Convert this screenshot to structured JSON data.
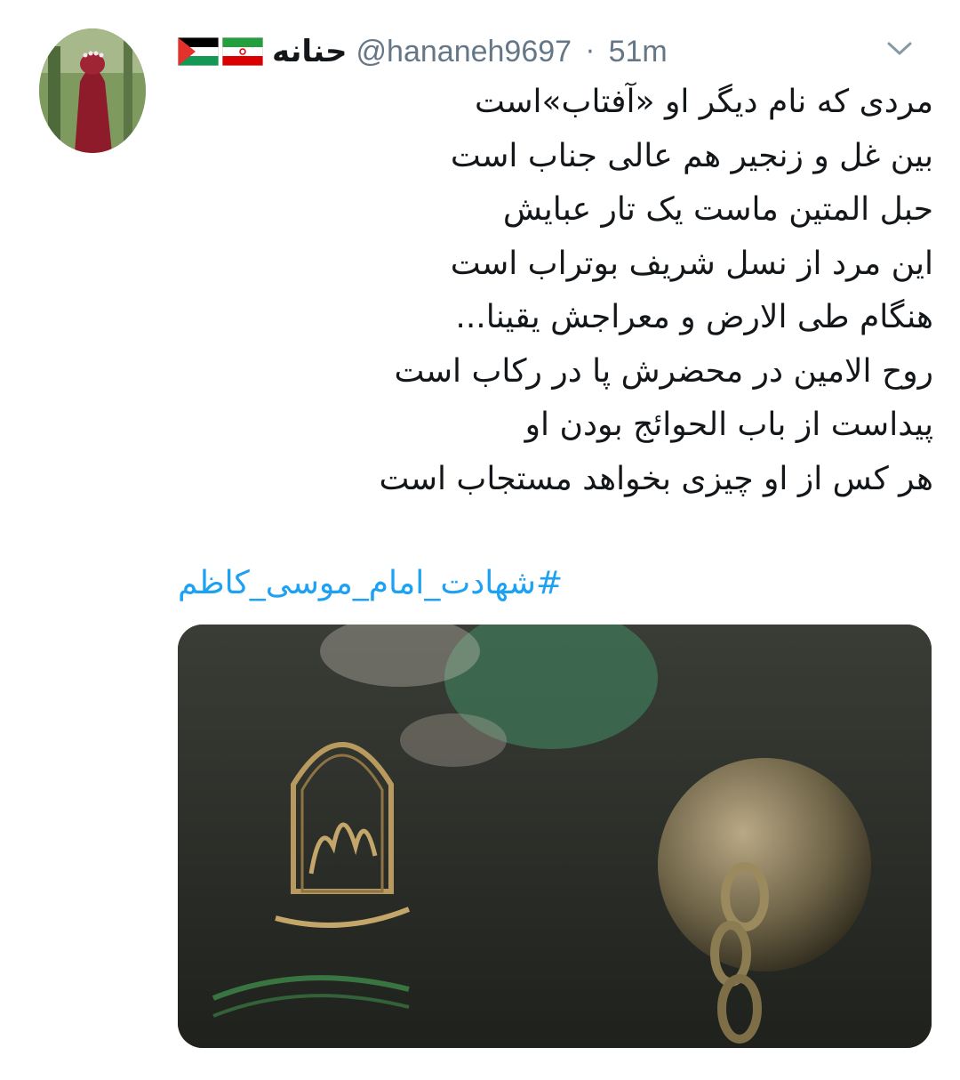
{
  "tweet": {
    "display_name": "حنانه",
    "flags": [
      "palestine-flag",
      "iran-flag"
    ],
    "handle": "@hananeh9697",
    "separator": "·",
    "time": "51m",
    "lines": [
      "مردی که نام دیگر او «آفتاب»است",
      "بین غل و زنجیر هم عالی جناب است",
      "حبل المتین ماست یک تار عبایش",
      "این مرد از نسل شریف بوتراب است",
      "هنگام طی الارض و معراجش یقینا...",
      "روح الامین در محضرش پا در رکاب است",
      "پیداست از باب الحوائج بودن او",
      "هر کس از او چیزی بخواهد مستجاب است"
    ],
    "hashtag": "#شهادت_امام_موسی_کاظم",
    "media_icon": "calligraphy-and-chain-ball-image"
  },
  "colors": {
    "link": "#1da1f2",
    "secondary_text": "#657786",
    "primary_text": "#14171a"
  }
}
